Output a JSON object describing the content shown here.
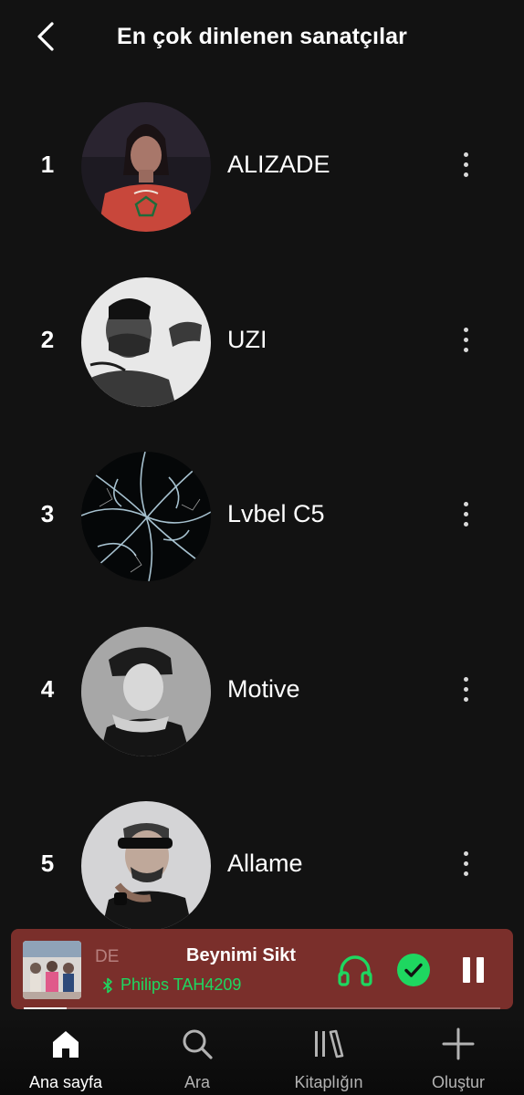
{
  "header": {
    "title": "En çok dinlenen sanatçılar",
    "back_icon": "chevron-left-icon"
  },
  "artists": [
    {
      "rank": "1",
      "name": "ALIZADE"
    },
    {
      "rank": "2",
      "name": "UZI"
    },
    {
      "rank": "3",
      "name": "Lvbel C5"
    },
    {
      "rank": "4",
      "name": "Motive"
    },
    {
      "rank": "5",
      "name": "Allame"
    }
  ],
  "now_playing": {
    "title_prefix": "DE",
    "title": "Beynimi Sikt",
    "device": "Philips TAH4209",
    "device_icon": "bluetooth-icon",
    "progress": 0.09,
    "background_color": "#7a2f2b",
    "accent_color": "#1ed760"
  },
  "nav": [
    {
      "label": "Ana sayfa",
      "icon": "home-icon",
      "active": true
    },
    {
      "label": "Ara",
      "icon": "search-icon",
      "active": false
    },
    {
      "label": "Kitaplığın",
      "icon": "library-icon",
      "active": false
    },
    {
      "label": "Oluştur",
      "icon": "plus-icon",
      "active": false
    }
  ]
}
